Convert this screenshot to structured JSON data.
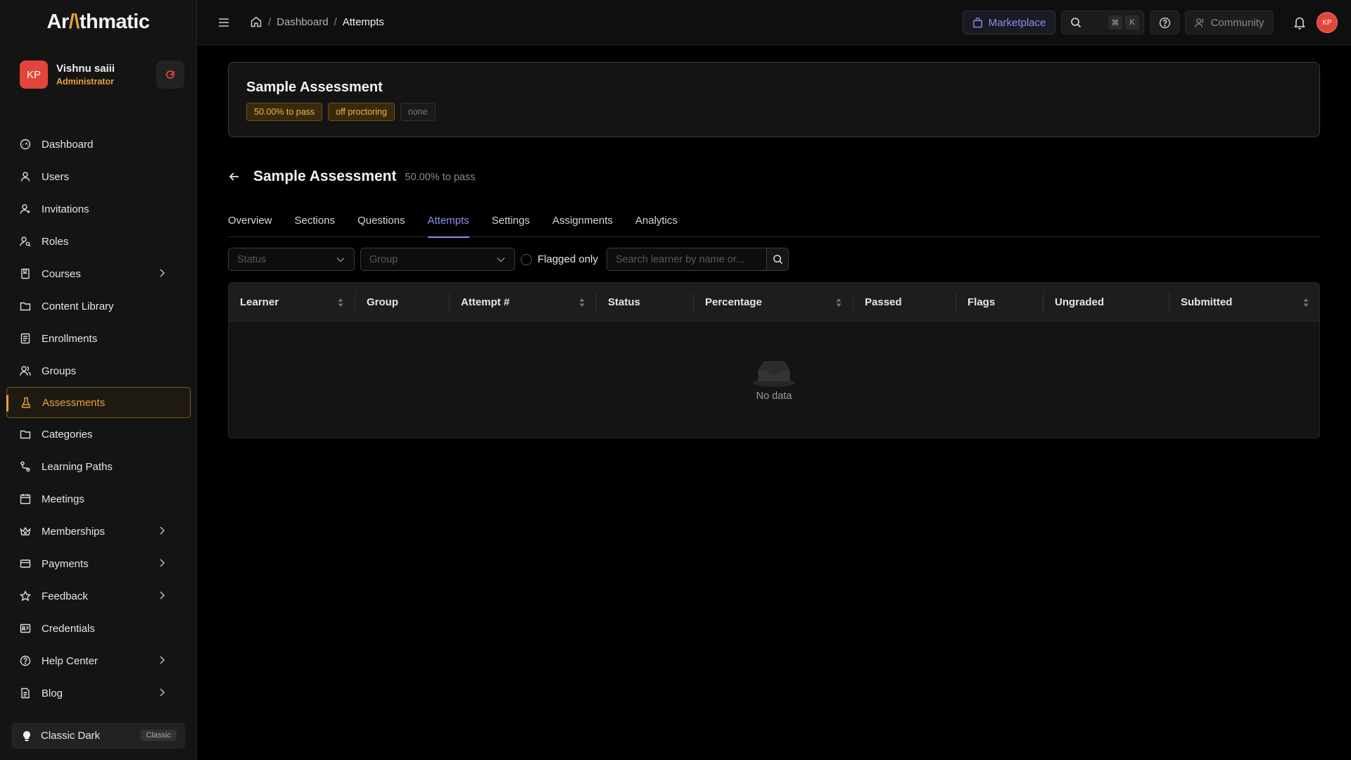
{
  "app": {
    "logo_text": "Arithmatic"
  },
  "user": {
    "initials": "KP",
    "name": "Vishnu saiii",
    "role": "Administrator"
  },
  "sidebar": {
    "items": [
      {
        "label": "Dashboard",
        "icon": "dashboard-icon"
      },
      {
        "label": "Users",
        "icon": "user-icon"
      },
      {
        "label": "Invitations",
        "icon": "user-plus-icon"
      },
      {
        "label": "Roles",
        "icon": "roles-icon"
      },
      {
        "label": "Courses",
        "icon": "book-icon",
        "expandable": true
      },
      {
        "label": "Content Library",
        "icon": "folder-icon"
      },
      {
        "label": "Enrollments",
        "icon": "clipboard-icon"
      },
      {
        "label": "Groups",
        "icon": "group-icon"
      },
      {
        "label": "Assessments",
        "icon": "flask-icon",
        "active": true
      },
      {
        "label": "Categories",
        "icon": "folder-icon"
      },
      {
        "label": "Learning Paths",
        "icon": "path-icon"
      },
      {
        "label": "Meetings",
        "icon": "calendar-icon"
      },
      {
        "label": "Memberships",
        "icon": "crown-icon",
        "expandable": true
      },
      {
        "label": "Payments",
        "icon": "credit-card-icon",
        "expandable": true
      },
      {
        "label": "Feedback",
        "icon": "star-icon",
        "expandable": true
      },
      {
        "label": "Credentials",
        "icon": "id-card-icon"
      },
      {
        "label": "Help Center",
        "icon": "help-icon",
        "expandable": true
      },
      {
        "label": "Blog",
        "icon": "document-icon",
        "expandable": true
      }
    ],
    "theme": {
      "label": "Classic Dark",
      "badge": "Classic"
    }
  },
  "topbar": {
    "breadcrumb": [
      "Dashboard",
      "Attempts"
    ],
    "marketplace_label": "Marketplace",
    "shortcut_keys": [
      "⌘",
      "K"
    ],
    "community_label": "Community",
    "avatar_initials": "KP"
  },
  "assessment_card": {
    "title": "Sample Assessment",
    "tags": [
      "50.00% to pass",
      "off proctoring",
      "none"
    ]
  },
  "page": {
    "title": "Sample Assessment",
    "subtitle": "50.00% to pass",
    "tabs": [
      "Overview",
      "Sections",
      "Questions",
      "Attempts",
      "Settings",
      "Assignments",
      "Analytics"
    ],
    "active_tab": "Attempts"
  },
  "filters": {
    "status_placeholder": "Status",
    "group_placeholder": "Group",
    "flagged_label": "Flagged only",
    "flagged_checked": false,
    "search_placeholder": "Search learner by name or..."
  },
  "table": {
    "columns": [
      {
        "label": "Learner",
        "sortable": true
      },
      {
        "label": "Group",
        "sortable": false
      },
      {
        "label": "Attempt #",
        "sortable": true
      },
      {
        "label": "Status",
        "sortable": false
      },
      {
        "label": "Percentage",
        "sortable": true
      },
      {
        "label": "Passed",
        "sortable": false
      },
      {
        "label": "Flags",
        "sortable": false
      },
      {
        "label": "Ungraded",
        "sortable": false
      },
      {
        "label": "Submitted",
        "sortable": true
      }
    ],
    "rows": [],
    "empty_text": "No data"
  },
  "colors": {
    "accent_gold": "#e8a23a",
    "accent_purple": "#8f8ff0",
    "avatar_red": "#e2453a"
  }
}
